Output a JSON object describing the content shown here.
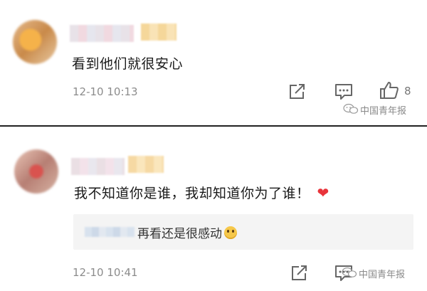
{
  "comments": [
    {
      "text": "看到他们就很安心",
      "timestamp": "12-10 10:13",
      "like_count": "8"
    },
    {
      "text": "我不知道你是谁，我却知道你为了谁！",
      "timestamp": "12-10 10:41",
      "reply": {
        "text": "再看还是很感动"
      }
    }
  ],
  "watermark": {
    "text": "中国青年报"
  },
  "icons": {
    "share": "share-icon",
    "comment": "comment-icon",
    "like": "like-icon",
    "heart": "heart-emoji",
    "emoji": "tearful-face-emoji",
    "wechat": "wechat-logo"
  },
  "colors": {
    "heart": "#e8343b",
    "reply_background": "#f4f4f4",
    "meta_text": "#8c8c8c"
  }
}
